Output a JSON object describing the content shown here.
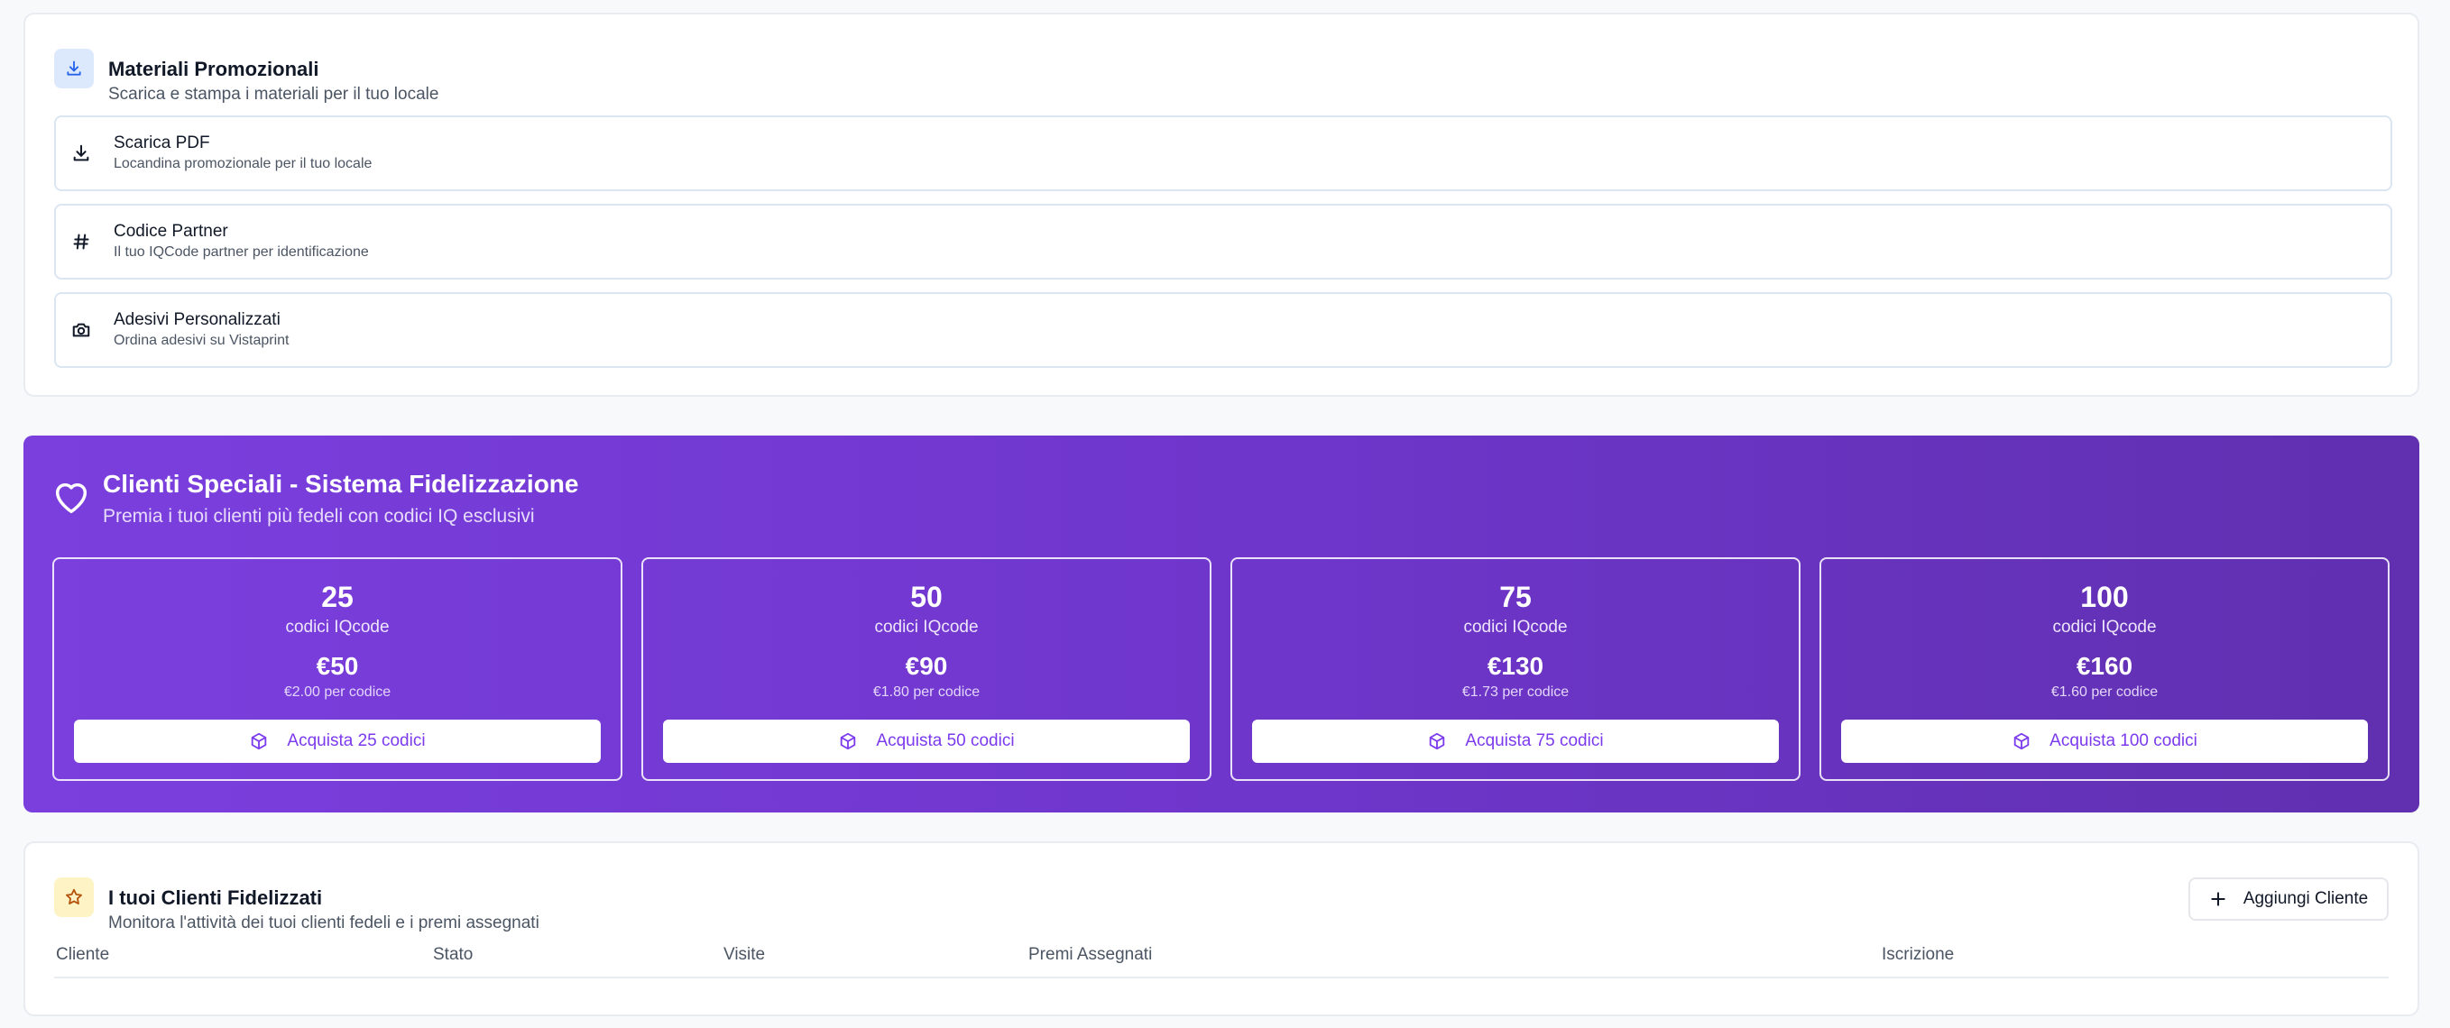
{
  "materiali": {
    "title": "Materiali Promozionali",
    "subtitle": "Scarica e stampa i materiali per il tuo locale",
    "icon": "download-icon",
    "items": [
      {
        "title": "Scarica PDF",
        "subtitle": "Locandina promozionale per il tuo locale",
        "icon": "download-icon"
      },
      {
        "title": "Codice Partner",
        "subtitle": "Il tuo IQCode partner per identificazione",
        "icon": "hash-icon"
      },
      {
        "title": "Adesivi Personalizzati",
        "subtitle": "Ordina adesivi su Vistaprint",
        "icon": "camera-icon"
      }
    ]
  },
  "fidelizzazione": {
    "title": "Clienti Speciali - Sistema Fidelizzazione",
    "subtitle": "Premia i tuoi clienti più fedeli con codici IQ esclusivi",
    "icon": "heart-icon",
    "packages": [
      {
        "quantity": "25",
        "unit": "codici IQcode",
        "price": "€50",
        "per_code": "€2.00 per codice",
        "button": "Acquista 25 codici"
      },
      {
        "quantity": "50",
        "unit": "codici IQcode",
        "price": "€90",
        "per_code": "€1.80 per codice",
        "button": "Acquista 50 codici"
      },
      {
        "quantity": "75",
        "unit": "codici IQcode",
        "price": "€130",
        "per_code": "€1.73 per codice",
        "button": "Acquista 75 codici"
      },
      {
        "quantity": "100",
        "unit": "codici IQcode",
        "price": "€160",
        "per_code": "€1.60 per codice",
        "button": "Acquista 100 codici"
      }
    ]
  },
  "clienti": {
    "title": "I tuoi Clienti Fidelizzati",
    "subtitle": "Monitora l'attività dei tuoi clienti fedeli e i premi assegnati",
    "icon": "star-icon",
    "add_button": "Aggiungi Cliente",
    "columns": [
      "Cliente",
      "Stato",
      "Visite",
      "Premi Assegnati",
      "Iscrizione"
    ]
  },
  "colors": {
    "accent": "#7c3aed",
    "banner_start": "#7b3fde",
    "banner_end": "#6030b0"
  }
}
